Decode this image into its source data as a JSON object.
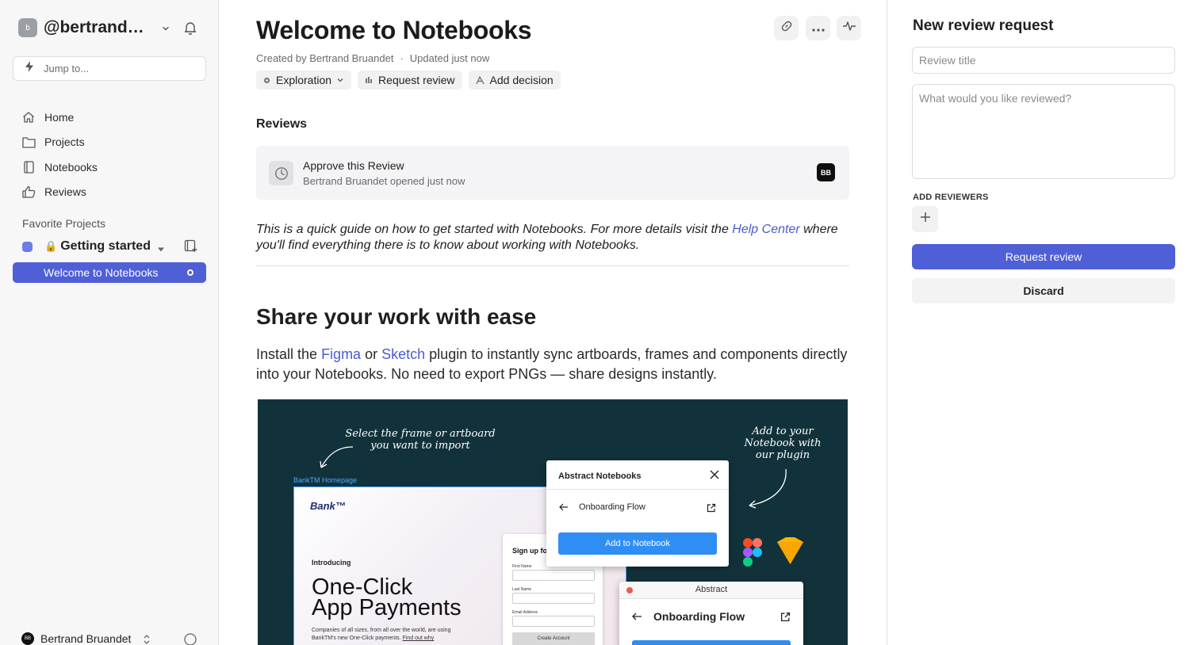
{
  "sidebar": {
    "account": {
      "avatar": "b",
      "name": "@bertrandbruandet"
    },
    "jump_placeholder": "Jump to...",
    "nav": [
      {
        "label": "Home",
        "icon": "home-icon"
      },
      {
        "label": "Projects",
        "icon": "folder-icon"
      },
      {
        "label": "Notebooks",
        "icon": "notebook-icon"
      },
      {
        "label": "Reviews",
        "icon": "thumbs-up-icon"
      }
    ],
    "favorites_heading": "Favorite Projects",
    "favorite_project": {
      "lock": "🔒",
      "name": "Getting started",
      "color": "#6f7ce6"
    },
    "active_notebook": "Welcome to Notebooks",
    "user": {
      "initials": "BB",
      "name": "Bertrand Bruandet"
    }
  },
  "main": {
    "title": "Welcome to Notebooks",
    "meta": {
      "created": "Created by Bertrand Bruandet",
      "sep": "·",
      "updated": "Updated just now"
    },
    "chips": {
      "exploration": "Exploration",
      "request_review": "Request review",
      "add_decision": "Add decision"
    },
    "reviews_heading": "Reviews",
    "review": {
      "title": "Approve this Review",
      "subtitle": "Bertrand Bruandet opened just now",
      "badge": "BB"
    },
    "intro": {
      "text": "This is a quick guide on how to get started with Notebooks. For more details visit the",
      "link": "Help Center",
      "text2": "where you'll find everything there is to know about working with Notebooks."
    },
    "share_heading": "Share your work with ease",
    "share": {
      "p1": "Install the",
      "figma": "Figma",
      "or": "or",
      "sketch": "Sketch",
      "p2": "plugin to instantly sync artboards, frames and components directly into your Notebooks. No need to export PNGs — share designs instantly."
    },
    "illustration": {
      "hand1_l1": "Select the frame or artboard",
      "hand1_l2": "you want to import",
      "hand2_l1": "Add to your",
      "hand2_l2": "Notebook with",
      "hand2_l3": "our plugin",
      "bank_label": "BankTM Homepage",
      "bank_logo": "Bank™",
      "bank_intro": "Introducing",
      "bank_big1": "One-Click",
      "bank_big2": "App Payments",
      "bank_small": "Companies of all sizes, from all over the world, are using BankTM's new One-Click payments.",
      "bank_small_link": "Find out why",
      "signup_title": "Sign up fo",
      "field1": "First Name",
      "field2": "Last Name",
      "field3": "Email Address",
      "signup_btn": "Create Account",
      "modal_title": "Abstract Notebooks",
      "modal_row": "Onboarding Flow",
      "modal_btn": "Add to Notebook",
      "abstract_title": "Abstract",
      "abstract_row": "Onboarding Flow"
    }
  },
  "panel": {
    "title": "New review request",
    "title_placeholder": "Review title",
    "desc_placeholder": "What would you like reviewed?",
    "add_reviewers": "ADD REVIEWERS",
    "request_btn": "Request review",
    "discard_btn": "Discard"
  },
  "colors": {
    "accent": "#4f5fd6",
    "link": "#4b5bd0",
    "illustration_bg": "#12323b"
  }
}
